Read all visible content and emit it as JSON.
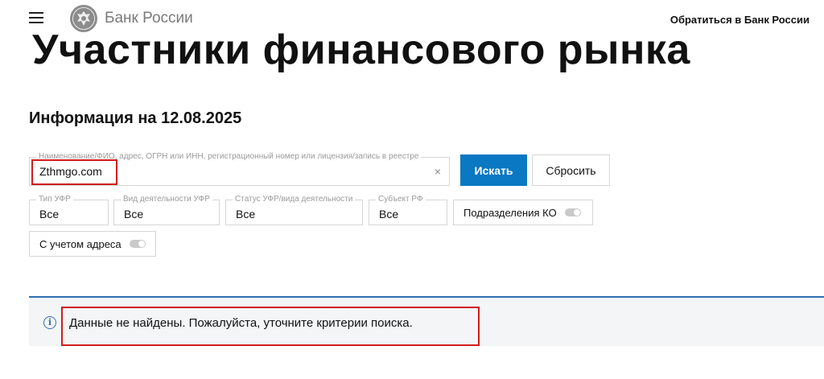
{
  "header": {
    "brand": "Банк России",
    "contact_link": "Обратиться в Банк России"
  },
  "page": {
    "title": "Участники финансового рынка",
    "info_date": "Информация на 12.08.2025"
  },
  "search": {
    "label": "Наименование/ФИО, адрес, ОГРН или ИНН, регистрационный номер или лицензия/запись в реестре",
    "value": "Zthmgo.com",
    "clear": "×",
    "search_label": "Искать",
    "reset_label": "Сбросить"
  },
  "filters": [
    {
      "label": "Тип УФР",
      "value": "Все"
    },
    {
      "label": "Вид деятельности УФР",
      "value": "Все"
    },
    {
      "label": "Статус УФР/вида деятельности",
      "value": "Все"
    },
    {
      "label": "Субъект РФ",
      "value": "Все"
    }
  ],
  "toggles": {
    "ko_subdivisions": {
      "label": "Подразделения КО",
      "on": false
    },
    "with_address": {
      "label": "С учетом адреса",
      "on": false
    }
  },
  "result": {
    "icon": "i",
    "message": "Данные не найдены. Пожалуйста, уточните критерии поиска."
  },
  "colors": {
    "accent": "#0a78c2",
    "highlight": "#d11c1c",
    "panel_border": "#2d6fb3"
  }
}
